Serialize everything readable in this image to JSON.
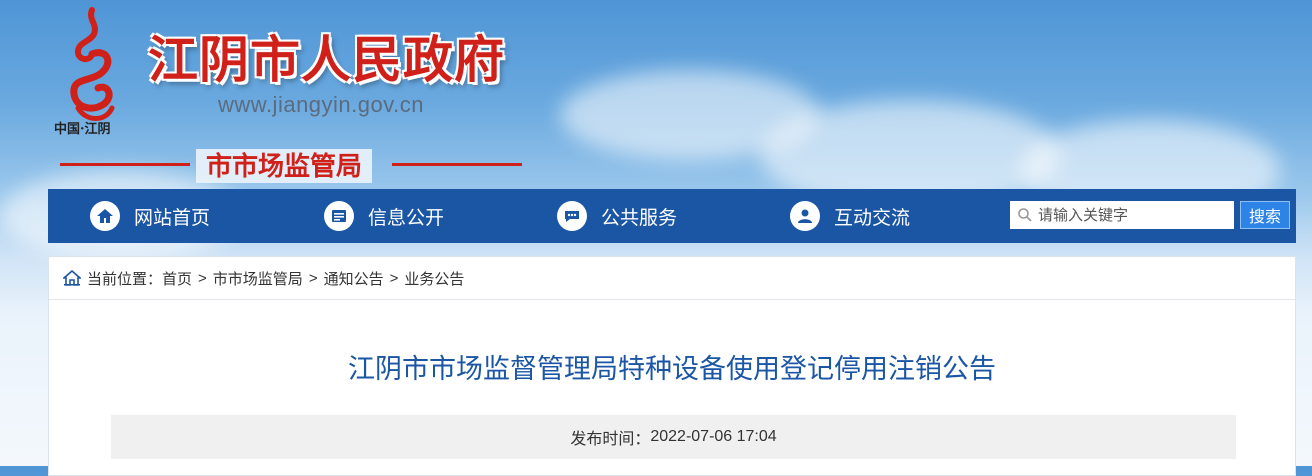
{
  "header": {
    "logo_caption": "中国·江阴",
    "site_title": "江阴市人民政府",
    "site_url": "www.jiangyin.gov.cn",
    "department": "市市场监管局"
  },
  "nav": {
    "items": [
      {
        "label": "网站首页",
        "icon": "home-icon"
      },
      {
        "label": "信息公开",
        "icon": "info-disclosure-icon"
      },
      {
        "label": "公共服务",
        "icon": "public-service-icon"
      },
      {
        "label": "互动交流",
        "icon": "interaction-icon"
      }
    ],
    "search": {
      "placeholder": "请输入关键字",
      "button_label": "搜索"
    }
  },
  "breadcrumb": {
    "prefix": "当前位置：",
    "items": [
      "首页",
      "市市场监管局",
      "通知公告",
      "业务公告"
    ],
    "separator": ">"
  },
  "article": {
    "title": "江阴市市场监督管理局特种设备使用登记停用注销公告",
    "publish_label": "发布时间：",
    "publish_time": "2022-07-06 17:04"
  },
  "colors": {
    "brand_red": "#d0201a",
    "nav_blue": "#1b56a5",
    "title_blue": "#1b56a5",
    "search_button": "#2d83e6"
  }
}
